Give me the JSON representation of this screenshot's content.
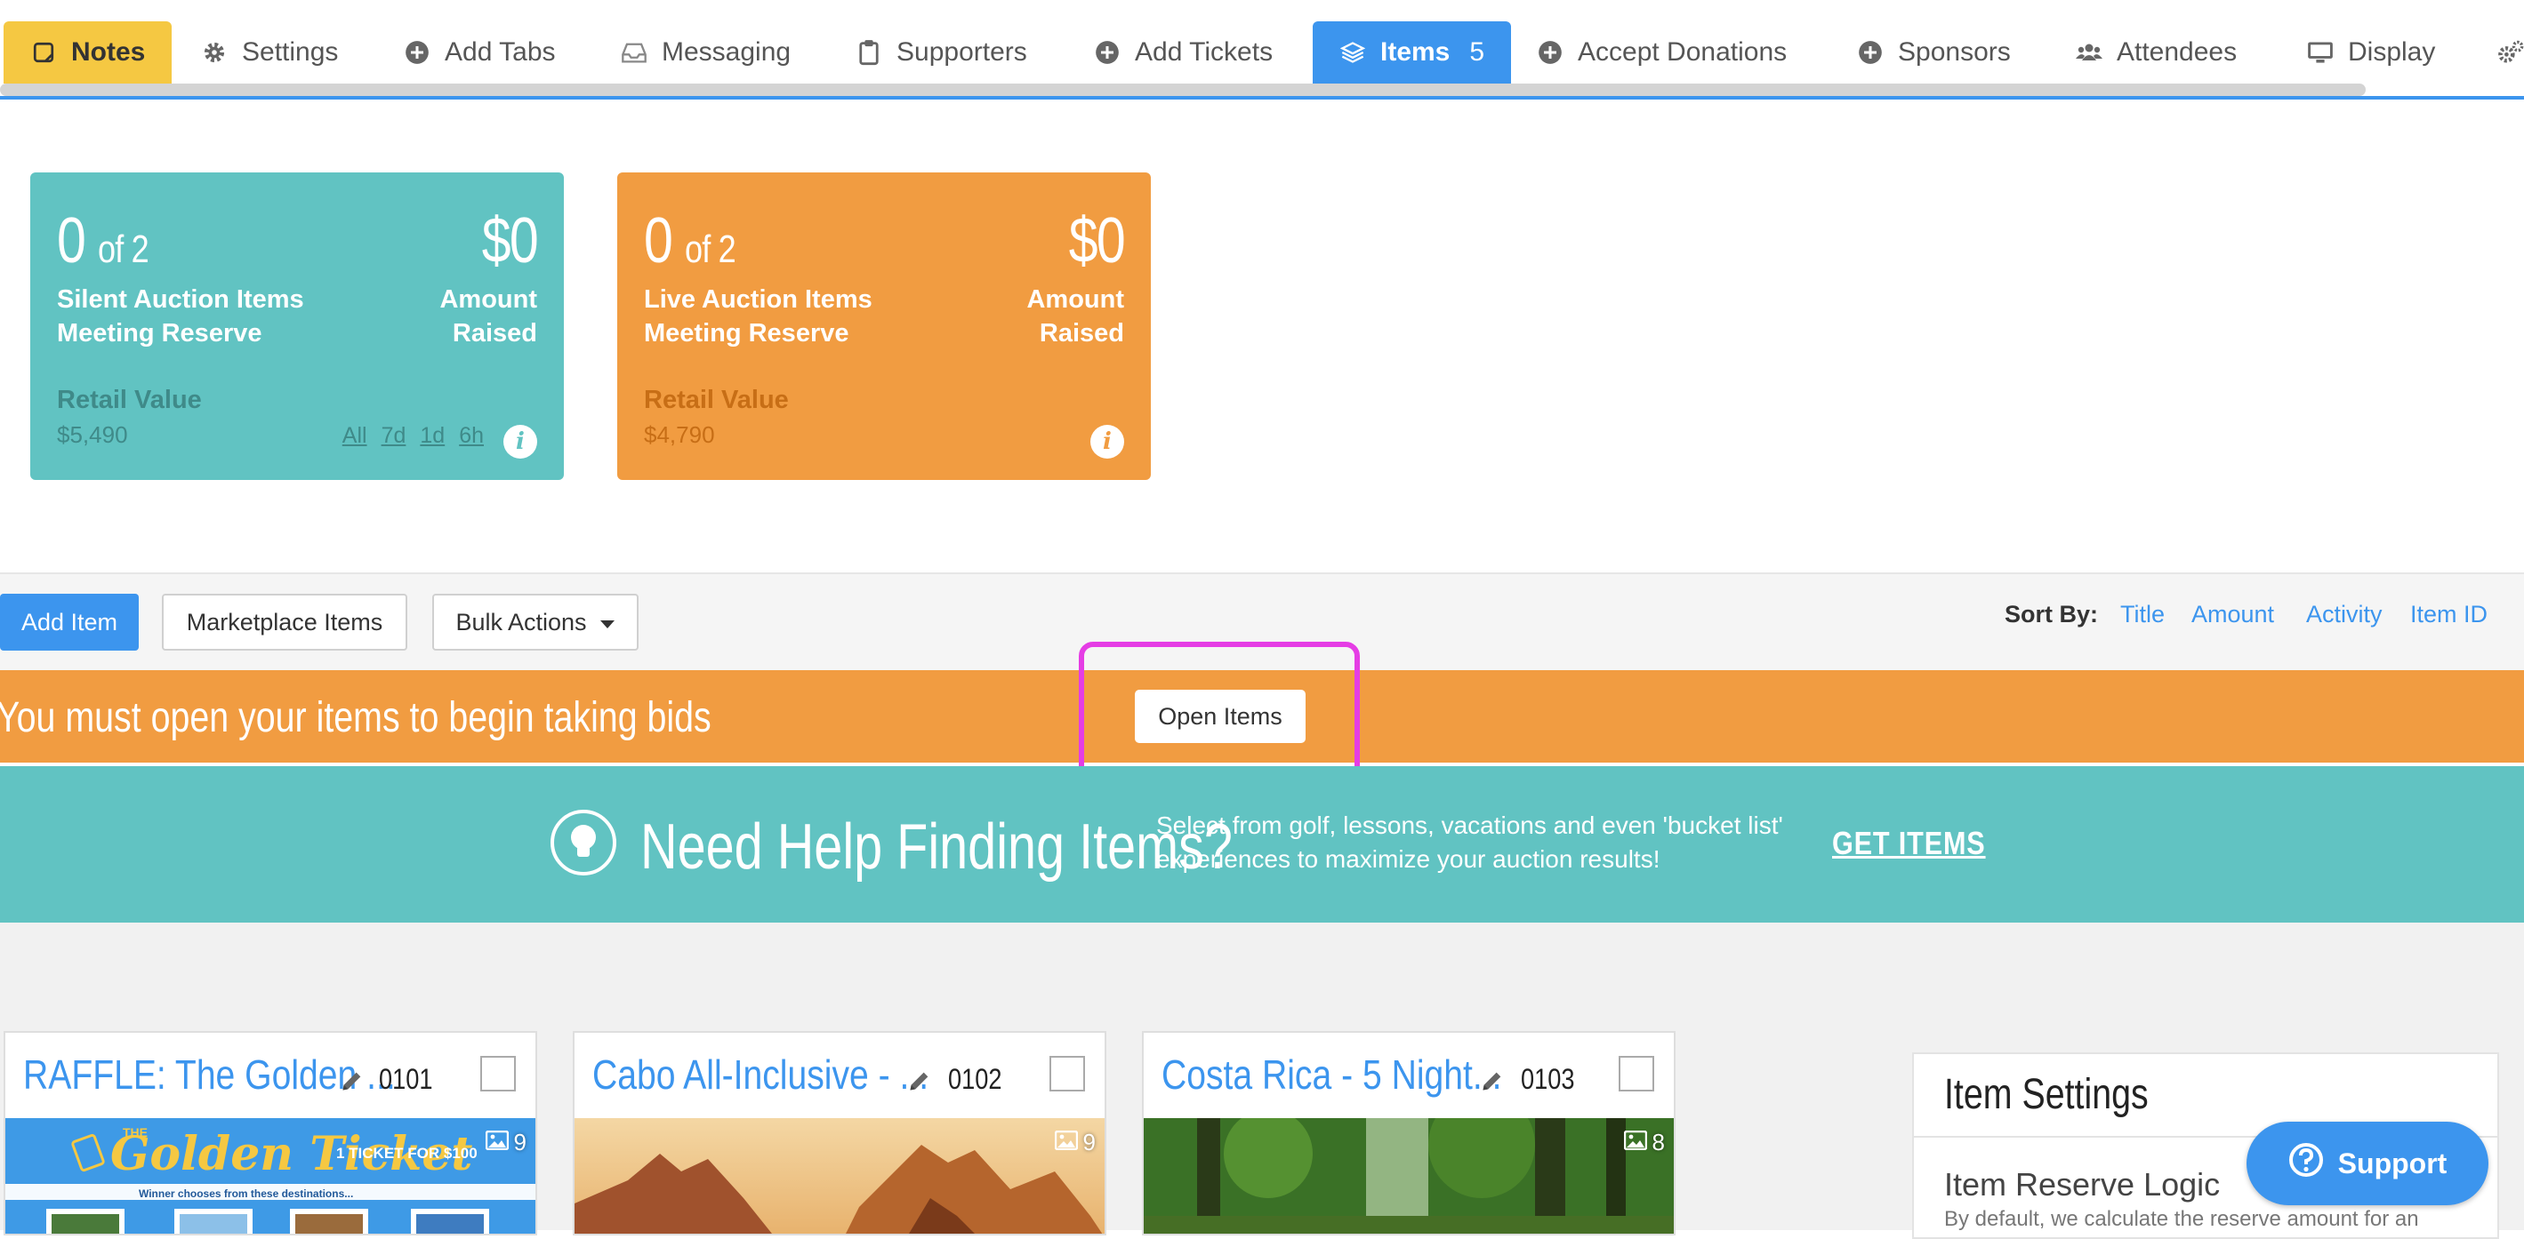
{
  "tabs": [
    {
      "label": "Notes",
      "icon": "note-icon"
    },
    {
      "label": "Settings",
      "icon": "gear-icon"
    },
    {
      "label": "Add Tabs",
      "icon": "plus-circle-icon"
    },
    {
      "label": "Messaging",
      "icon": "inbox-icon"
    },
    {
      "label": "Supporters",
      "icon": "clipboard-icon"
    },
    {
      "label": "Add Tickets",
      "icon": "plus-circle-icon"
    },
    {
      "label": "Items",
      "icon": "layers-icon",
      "count": "5"
    },
    {
      "label": "Accept Donations",
      "icon": "plus-circle-icon"
    },
    {
      "label": "Sponsors",
      "icon": "plus-circle-icon"
    },
    {
      "label": "Attendees",
      "icon": "users-icon"
    },
    {
      "label": "Display",
      "icon": "monitor-icon"
    }
  ],
  "stats": {
    "silent": {
      "count": "0",
      "of": "of 2",
      "line1": "Silent Auction Items",
      "line2": "Meeting Reserve",
      "amount": "$0",
      "amount_l1": "Amount",
      "amount_l2": "Raised",
      "retail_label": "Retail Value",
      "retail_value": "$5,490",
      "filters": [
        "All",
        "7d",
        "1d",
        "6h"
      ],
      "color": "#61c3c2"
    },
    "live": {
      "count": "0",
      "of": "of 2",
      "line1": "Live Auction Items",
      "line2": "Meeting Reserve",
      "amount": "$0",
      "amount_l1": "Amount",
      "amount_l2": "Raised",
      "retail_label": "Retail Value",
      "retail_value": "$4,790",
      "color": "#f19c41"
    }
  },
  "actions": {
    "add_item": "Add Item",
    "marketplace": "Marketplace Items",
    "bulk": "Bulk Actions",
    "sort_label": "Sort By:",
    "sort_options": [
      "Title",
      "Amount",
      "Activity",
      "Item ID"
    ]
  },
  "open_banner": {
    "text": "You must open your items to begin taking bids",
    "button": "Open Items"
  },
  "help_banner": {
    "title": "Need Help Finding Items?",
    "description": "Select from golf, lessons, vacations and even 'bucket list' experiences to maximize your auction results!",
    "cta": "GET ITEMS"
  },
  "items": [
    {
      "title": "RAFFLE: The Golden ...",
      "id": "0101",
      "images": "9",
      "banner_title": "Golden Ticket",
      "banner_the": "THE",
      "banner_price": "1 TICKET FOR $100",
      "banner_sub": "Winner chooses from these destinations..."
    },
    {
      "title": "Cabo All-Inclusive - ...",
      "id": "0102",
      "images": "9"
    },
    {
      "title": "Costa Rica - 5 Night...",
      "id": "0103",
      "images": "8"
    }
  ],
  "item_settings": {
    "header": "Item Settings",
    "reserve_title": "Item Reserve Logic",
    "reserve_desc": "By default, we calculate the reserve amount for an"
  },
  "support": {
    "label": "Support"
  },
  "colors": {
    "accent": "#3c95ee",
    "teal": "#61c3c2",
    "orange": "#f19c41",
    "notes_tab": "#f5c842",
    "highlight": "#e53de5"
  }
}
